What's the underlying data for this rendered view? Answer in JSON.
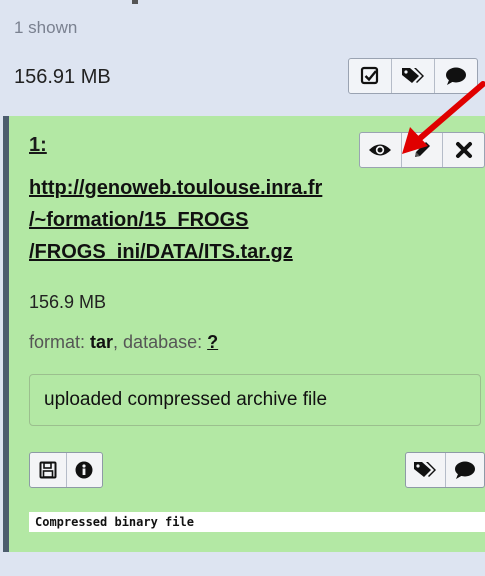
{
  "history": {
    "shown_text": "1 shown",
    "total_size": "156.91 MB",
    "icons": [
      "check-square-icon",
      "tags-icon",
      "comment-icon"
    ]
  },
  "dataset": {
    "hid": "1:",
    "title_lines": [
      "http://genoweb.toulouse.inra.fr",
      "/~formation/15_FROGS",
      "/FROGS_ini/DATA/ITS.tar.gz"
    ],
    "size": "156.9 MB",
    "format_label": "format:",
    "format_value": "tar",
    "database_label": ", database:",
    "database_value": "?",
    "info": "uploaded compressed archive file",
    "peek": "Compressed binary file",
    "action_icons": [
      "eye-icon",
      "pencil-icon",
      "close-icon"
    ],
    "left_icons": [
      "save-icon",
      "info-icon"
    ],
    "right_icons": [
      "tags-icon",
      "comment-icon"
    ]
  },
  "colors": {
    "dataset_bg": "#b3e8a4",
    "annotation_arrow": "#e00000"
  }
}
